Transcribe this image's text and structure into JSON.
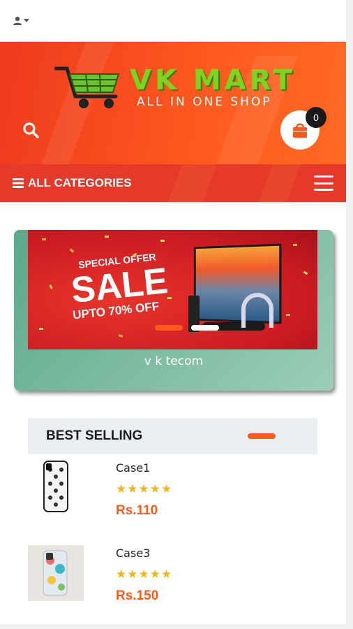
{
  "topbar": {
    "user_icon": "user-icon",
    "caret_icon": "caret-down-icon"
  },
  "header": {
    "brand": "VK MART",
    "tagline": "ALL IN ONE SHOP",
    "cart_count": "0",
    "search_icon": "search-icon",
    "cart_icon": "shopping-bag-icon"
  },
  "nav": {
    "all_categories": "ALL CATEGORIES",
    "menu_icon": "hamburger-menu-icon"
  },
  "slider": {
    "offer_label": "SPECIAL OFFER",
    "offer_title": "SALE",
    "offer_subtitle": "UPTO 70% OFF",
    "caption": "v k tecom",
    "active_dot": 1
  },
  "best_selling": {
    "title": "BEST SELLING",
    "products": [
      {
        "name": "Case1",
        "rating": 5,
        "price": "Rs.110"
      },
      {
        "name": "Case3",
        "rating": 5,
        "price": "Rs.150"
      }
    ]
  },
  "colors": {
    "primary": "#ff5a1a",
    "header_red": "#ee3a1e",
    "brand_green": "#7ed321",
    "star": "#f5b515"
  }
}
